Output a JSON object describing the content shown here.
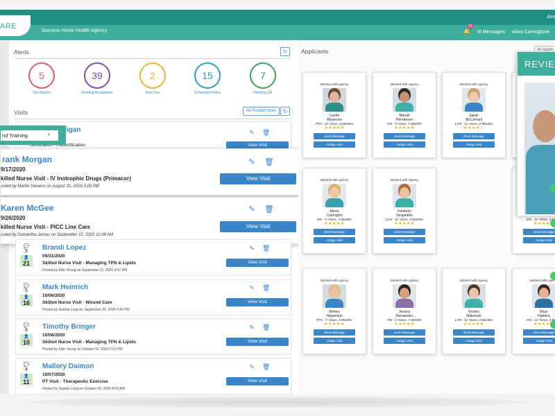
{
  "header": {
    "logo_fragment": "ARE",
    "agency": "Success Home Health Agency",
    "brand_fragment": "Axx",
    "notification_count": "21",
    "messages_label": "Messages",
    "user_name": "Alex Carrington"
  },
  "alerts": {
    "title": "Alerts",
    "items": [
      {
        "value": "5",
        "label": "Not Started",
        "color": "#e0596b"
      },
      {
        "value": "39",
        "label": "Pending Acceptance",
        "color": "#7b4fa8"
      },
      {
        "value": "2",
        "label": "Past Due",
        "color": "#f0b429"
      },
      {
        "value": "15",
        "label": "Scheduled Today",
        "color": "#2e9dba"
      },
      {
        "value": "7",
        "label": "Pending QA",
        "color": "#3aa655"
      }
    ]
  },
  "visits": {
    "title": "Visits",
    "all_posted_label": "All Posted Visits",
    "view_label": "View Visit",
    "menu_item": "nd Training",
    "background_fragment": {
      "name": "rrigan",
      "desc": "certification - Recertification"
    },
    "popouts": [
      {
        "name": "rank Morgan",
        "date": "9/17/2020",
        "desc": "killed Nurse Visit - IV Inotrophic Drugs (Primacor)",
        "posted": "osted by Martin Stevens on August 31, 2020 3:05 PM"
      },
      {
        "name": "Karen McGee",
        "date": "9/26/2020",
        "desc": "killed Nurse Visit - PICC Line Care",
        "posted": "osted by Samantha James on September 12, 2020 11:08 AM"
      }
    ],
    "rows": [
      {
        "messages": "9",
        "applicants": "21",
        "name": "Brandi Lopez",
        "date": "09/31/2020",
        "desc": "Skilled Nurse Visit - Managing TPN & Lipids",
        "posted": "Posted by Ellie Young on September 21, 2020 4:51 PM"
      },
      {
        "messages": "5",
        "applicants": "16",
        "name": "Mark Heinrich",
        "date": "10/06/2020",
        "desc": "Skilled Nurse Visit - Wound Care",
        "posted": "Posted by Debbie Long on September 22, 2020 4:56 PM"
      },
      {
        "messages": "9",
        "applicants": "10",
        "name": "Timothy Bringer",
        "date": "10/06/2020",
        "desc": "Skilled Nurse Visit - Managing TPN & Lipids",
        "posted": "Posted by Ellie Young on October 02, 2020 5:01 PM"
      },
      {
        "messages": "4",
        "applicants": "11",
        "name": "Mallory Daimon",
        "date": "10/07/2020",
        "desc": "PT Visit - Therapeutic Exercise",
        "posted": "Posted by Debbie Long on October 05, 2020 8:03 AM"
      }
    ]
  },
  "applicants": {
    "title": "Applicants",
    "all_label": "All Applic",
    "worked_label": "Worked with Agency",
    "send_label": "Send Message",
    "assign_label": "Assign Visit",
    "review_label": "REVIEW",
    "cards": [
      {
        "first": "Lisette",
        "last": "Meyerson",
        "meta": "PTA - 27 Years, 5 Months",
        "stars": "★★★★★",
        "skin": "#e0b49a",
        "hair": "#6b4a2e",
        "shirt": "#2f8f8a",
        "bg": "#cfd8df"
      },
      {
        "first": "Mariah",
        "last": "Henderson",
        "meta": "RN - 5 Years, 7 Months",
        "stars": "★★★★★",
        "skin": "#c99473",
        "hair": "#2f2a26",
        "shirt": "#3fb0a8",
        "bg": "#d6dde2"
      },
      {
        "first": "Sarah",
        "last": "McConnell",
        "meta": "LVN - 11 Years, 3 Months",
        "stars": "★★★★☆",
        "skin": "#ecc7ad",
        "hair": "#c9a36b",
        "shirt": "#3a86c8",
        "bg": "#e2e7eb"
      },
      {
        "first": "Jessica",
        "last": "Andreassen",
        "meta": "PTA - 7 Years, 5 Months",
        "stars": "★★★★★",
        "skin": "#e6b896",
        "hair": "#8a5a36",
        "shirt": "#4bb5c1",
        "bg": "#d9e0e4"
      },
      {
        "first": "Alexis",
        "last": "Carrington",
        "meta": "RN - 5 Years, 7 Months",
        "stars": "★★★★★",
        "skin": "#f0c8a8",
        "hair": "#d8b070",
        "shirt": "#3aa0b0",
        "bg": "#e4e8ea"
      },
      {
        "first": "Kimberly",
        "last": "Desjardins",
        "meta": "LVN - 11 Years, 3 Months",
        "stars": "★★★★★",
        "skin": "#eac3a5",
        "hair": "#b06a3a",
        "shirt": "#3fb0a8",
        "bg": "#dde4e8"
      },
      {
        "first": "LeSean",
        "last": "Peterson",
        "meta": "RN - 11 Years, 3 Month",
        "stars": "★★★★★",
        "skin": "#8a5a3c",
        "hair": "#1f1a17",
        "shirt": "#3a86c8",
        "bg": "#dfe5e9"
      },
      {
        "first": "Britney",
        "last": "Harperson",
        "meta": "PTA - 7 Years, 5 Months",
        "stars": "★★★★★",
        "skin": "#ecc3a5",
        "hair": "#e0c08a",
        "shirt": "#3a86c8",
        "bg": "#d4dce2"
      },
      {
        "first": "Jessica",
        "last": "Hernandez",
        "meta": "RN - 5 Years, 7 Months",
        "stars": "★★★★★",
        "skin": "#d9a07e",
        "hair": "#2a2420",
        "shirt": "#8a6fa8",
        "bg": "#e0e5e8"
      },
      {
        "first": "Kristen",
        "last": "Makenzie",
        "meta": "LVN - 11 Years, 3 Months",
        "stars": "★★★★★",
        "skin": "#edc6a8",
        "hair": "#4a3626",
        "shirt": "#3fb0a8",
        "bg": "#d8dfe4"
      },
      {
        "first": "Brian",
        "last": "Haddick",
        "meta": "RN - 11 Years, 3 Month",
        "stars": "★★★★★",
        "skin": "#e2b292",
        "hair": "#3a2a20",
        "shirt": "#2f6fa8",
        "bg": "#dde3e7"
      }
    ]
  },
  "icons": {
    "edit": "edit-icon",
    "delete": "trash-icon",
    "refresh": "refresh-icon",
    "comment": "comment-icon",
    "person": "person-icon",
    "bell": "bell-icon",
    "envelope": "envelope-icon",
    "chevron": "chevron-right-icon"
  }
}
